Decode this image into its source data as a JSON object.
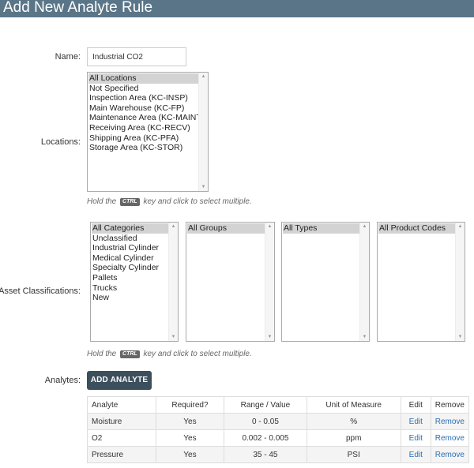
{
  "page": {
    "title": "Add New Analyte Rule"
  },
  "name_field": {
    "label": "Name:",
    "value": "Industrial CO2"
  },
  "locations": {
    "label": "Locations:",
    "options": [
      "All Locations",
      "Not Specified",
      "Inspection Area (KC-INSP)",
      "Main Warehouse (KC-FP)",
      "Maintenance Area (KC-MAINT)",
      "Receiving Area (KC-RECV)",
      "Shipping Area (KC-PFA)",
      "Storage Area (KC-STOR)"
    ],
    "selected": "All Locations"
  },
  "hint": {
    "pre": "Hold the",
    "key": "CTRL",
    "post": "key and click to select multiple."
  },
  "asset_classifications": {
    "label": "Asset Classifications:",
    "categories": {
      "options": [
        "All Categories",
        "Unclassified",
        "Industrial Cylinder",
        "Medical Cylinder",
        "Specialty Cylinder",
        "Pallets",
        "Trucks",
        "New"
      ],
      "selected": "All Categories"
    },
    "groups": {
      "options": [
        "All Groups"
      ],
      "selected": "All Groups"
    },
    "types": {
      "options": [
        "All Types"
      ],
      "selected": "All Types"
    },
    "product_codes": {
      "options": [
        "All Product Codes"
      ],
      "selected": "All Product Codes"
    }
  },
  "analytes": {
    "label": "Analytes:",
    "add_button": "ADD ANALYTE",
    "columns": [
      "Analyte",
      "Required?",
      "Range / Value",
      "Unit of Measure",
      "Edit",
      "Remove"
    ],
    "rows": [
      {
        "analyte": "Moisture",
        "required": "Yes",
        "range": "0 - 0.05",
        "unit": "%",
        "edit": "Edit",
        "remove": "Remove"
      },
      {
        "analyte": "O2",
        "required": "Yes",
        "range": "0.002 - 0.005",
        "unit": "ppm",
        "edit": "Edit",
        "remove": "Remove"
      },
      {
        "analyte": "Pressure",
        "required": "Yes",
        "range": "35 - 45",
        "unit": "PSI",
        "edit": "Edit",
        "remove": "Remove"
      }
    ]
  },
  "colors": {
    "header_bg": "#5a7588",
    "button_bg": "#3c4f5c",
    "link": "#2b6fb6",
    "selected_option": "#d3d3d3"
  }
}
